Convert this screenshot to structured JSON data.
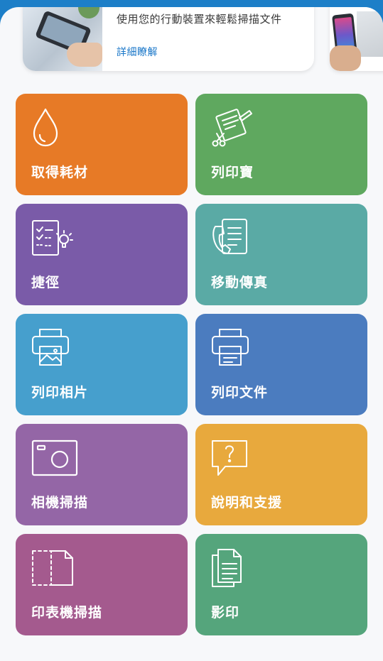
{
  "banner": {
    "text": "使用您的行動裝置來輕鬆掃描文件",
    "link": "詳細瞭解"
  },
  "tiles": [
    {
      "label": "取得耗材",
      "icon": "ink-drop-icon",
      "color": "#e77a26"
    },
    {
      "label": "列印寶",
      "icon": "printables-icon",
      "color": "#5fa85f"
    },
    {
      "label": "捷徑",
      "icon": "shortcuts-icon",
      "color": "#7a5ba8"
    },
    {
      "label": "移動傳真",
      "icon": "mobile-fax-icon",
      "color": "#5aaaa5"
    },
    {
      "label": "列印相片",
      "icon": "print-photo-icon",
      "color": "#469fcd"
    },
    {
      "label": "列印文件",
      "icon": "print-document-icon",
      "color": "#4b7cbf"
    },
    {
      "label": "相機掃描",
      "icon": "camera-scan-icon",
      "color": "#9466a6"
    },
    {
      "label": "說明和支援",
      "icon": "help-support-icon",
      "color": "#e8a93d"
    },
    {
      "label": "印表機掃描",
      "icon": "printer-scan-icon",
      "color": "#a45a8e"
    },
    {
      "label": "影印",
      "icon": "copy-icon",
      "color": "#55a57c"
    }
  ]
}
